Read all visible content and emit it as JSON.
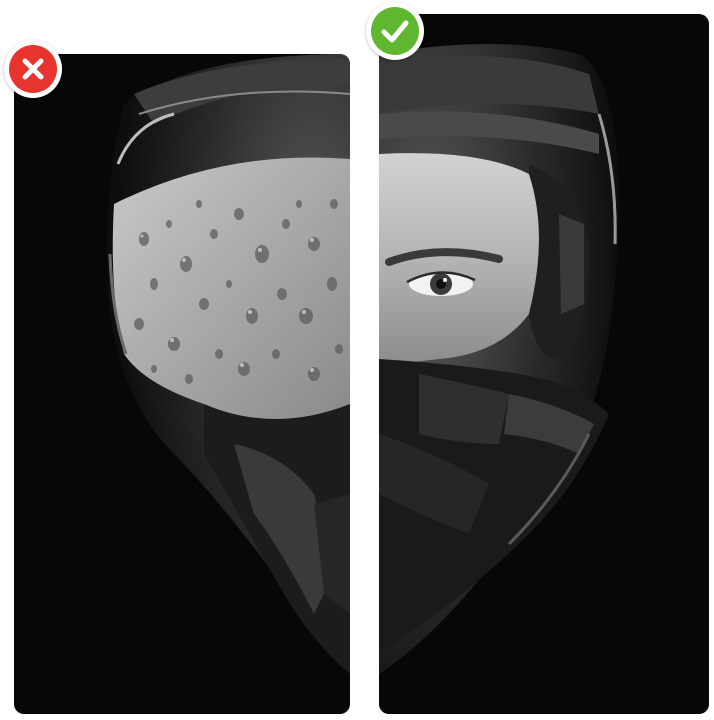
{
  "comparison": {
    "left": {
      "status": "wrong",
      "icon": "x-mark-icon",
      "color": "#e8342e"
    },
    "right": {
      "status": "correct",
      "icon": "check-mark-icon",
      "color": "#5fb72f"
    }
  },
  "colors": {
    "background": "#ffffff",
    "panel": "#070707",
    "helmet_shell": "#2a2a2a"
  }
}
